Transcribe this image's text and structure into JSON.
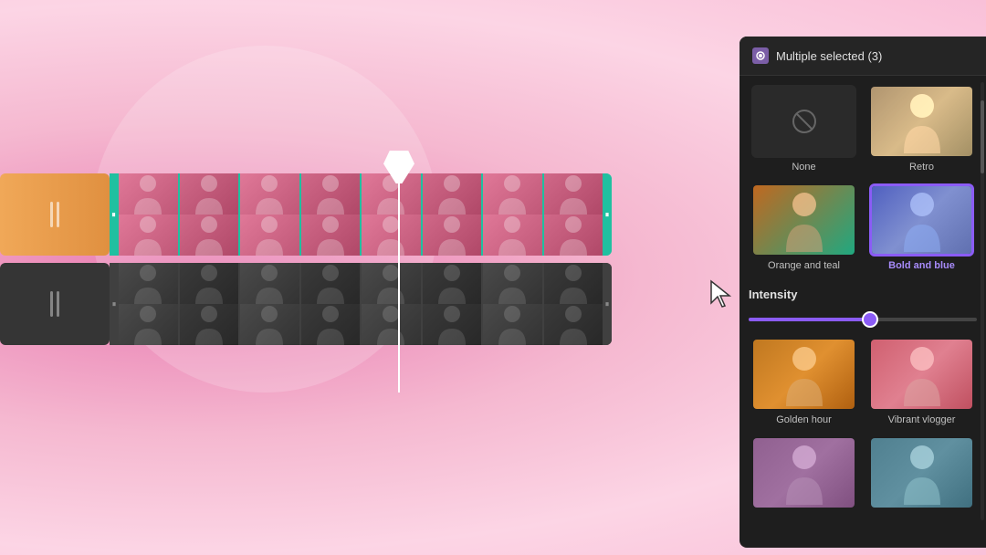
{
  "background": {
    "color": "#f0a0c0"
  },
  "panel": {
    "title": "Multiple selected (3)",
    "icon": "filter-icon",
    "filters": [
      {
        "id": "none",
        "label": "None",
        "selected": false,
        "type": "none"
      },
      {
        "id": "retro",
        "label": "Retro",
        "selected": false,
        "type": "retro"
      },
      {
        "id": "orange-teal",
        "label": "Orange and teal",
        "selected": false,
        "type": "orange-teal"
      },
      {
        "id": "bold-blue",
        "label": "Bold and blue",
        "selected": true,
        "type": "bold-blue"
      },
      {
        "id": "golden-hour",
        "label": "Golden hour",
        "selected": false,
        "type": "golden"
      },
      {
        "id": "vibrant-vlogger",
        "label": "Vibrant vlogger",
        "selected": false,
        "type": "vibrant"
      },
      {
        "id": "filter-7",
        "label": "",
        "selected": false,
        "type": "bottom1"
      },
      {
        "id": "filter-8",
        "label": "",
        "selected": false,
        "type": "bottom2"
      }
    ],
    "intensity": {
      "label": "Intensity",
      "value": 55,
      "min": 0,
      "max": 100
    }
  },
  "timeline": {
    "track1_handle_icon": "⏸",
    "track2_handle_icon": "⏸",
    "playhead_position": "436px"
  }
}
